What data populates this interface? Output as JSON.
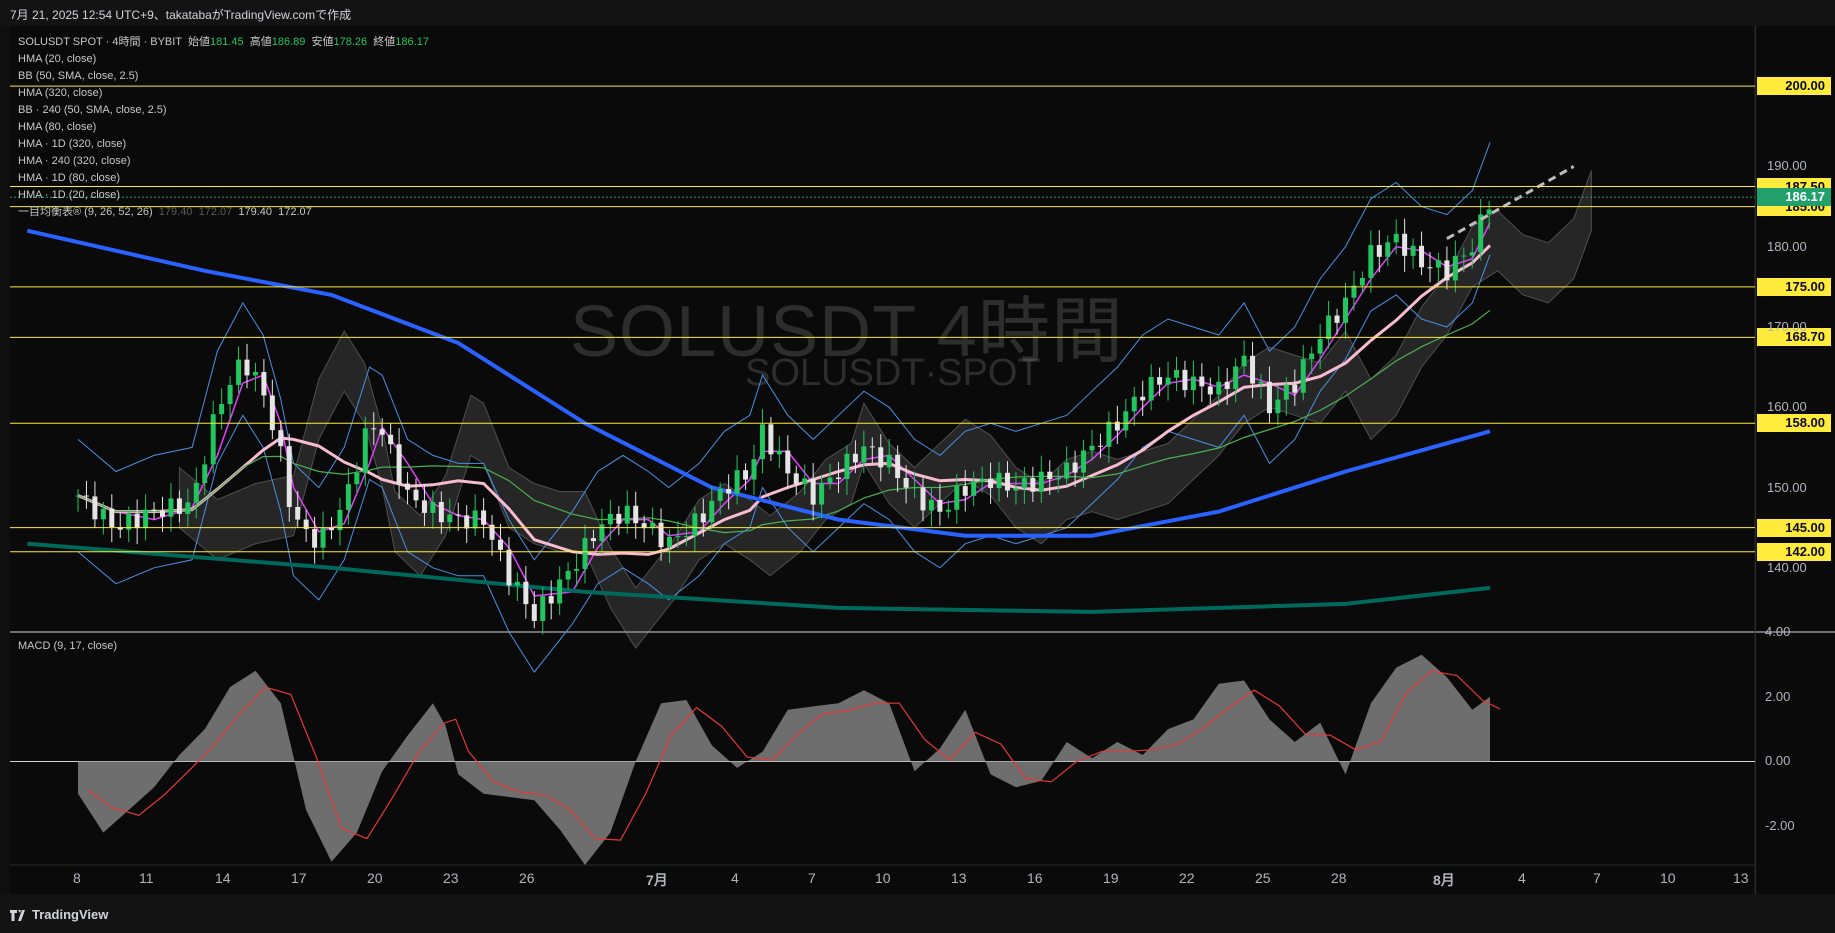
{
  "header": {
    "caption": "7月 21, 2025 12:54 UTC+9、takatabaがTradingView.comで作成"
  },
  "legend": {
    "symbol": "SOLUSDT SPOT · 4時間 · BYBIT",
    "open_label": "始値",
    "open": "181.45",
    "high_label": "高値",
    "high": "186.89",
    "low_label": "安値",
    "low": "178.26",
    "close_label": "終値",
    "close": "186.17",
    "indicators": [
      "HMA (20, close)",
      "BB (50, SMA, close, 2.5)",
      "HMA (320, close)",
      "BB · 240 (50, SMA, close, 2.5)",
      "HMA (80, close)",
      "HMA · 1D (320, close)",
      "HMA · 240 (320, close)",
      "HMA · 1D (80, close)",
      "HMA · 1D (20, close)"
    ],
    "ichimoku": "一目均衡表® (9, 26, 52, 26)",
    "ichimoku_values": [
      "179.40",
      "172.07",
      "179.40",
      "172.07"
    ],
    "macd": "MACD (9, 17, close)"
  },
  "watermark": {
    "line1": "SOLUSDT 4時間",
    "line2": "SOLUSDT·SPOT"
  },
  "colors": {
    "up": "#22c55e",
    "down": "#e5e5e5",
    "hma20": "#e040fb",
    "hma_pink": "#f8bbd0",
    "hma_blue": "#2962ff",
    "hma_teal": "#00695c",
    "bb": "#4a90e2",
    "green_ma": "#4caf50",
    "level": "#ffeb3b",
    "macd_hist": "#808080",
    "macd_signal": "#e53935"
  },
  "chart_data": [
    {
      "type": "candlestick",
      "title": "SOLUSDT SPOT · 4時間 · BYBIT",
      "ylim": [
        132,
        207
      ],
      "price_axis_ticks": [
        "190.00",
        "180.00",
        "170.00",
        "160.00",
        "150.00",
        "140.00"
      ],
      "horizontal_levels": [
        "200.00",
        "187.50",
        "185.00",
        "175.00",
        "168.70",
        "158.00",
        "145.00",
        "142.00"
      ],
      "current_price": "186.17",
      "x_ticks": [
        "8",
        "11",
        "14",
        "17",
        "20",
        "23",
        "26",
        "7月",
        "4",
        "7",
        "10",
        "13",
        "16",
        "19",
        "22",
        "25",
        "28",
        "8月",
        "4",
        "7",
        "10",
        "13"
      ],
      "price_path": [
        [
          0,
          149
        ],
        [
          1.5,
          145
        ],
        [
          3,
          147
        ],
        [
          4.5,
          148
        ],
        [
          5.5,
          160
        ],
        [
          6.5,
          166
        ],
        [
          7.3,
          162
        ],
        [
          8,
          154
        ],
        [
          8.5,
          146
        ],
        [
          9.5,
          143
        ],
        [
          10.5,
          148
        ],
        [
          11.5,
          158
        ],
        [
          12,
          157
        ],
        [
          13,
          149
        ],
        [
          14,
          147
        ],
        [
          15,
          146
        ],
        [
          16,
          146
        ],
        [
          17,
          139
        ],
        [
          18,
          134
        ],
        [
          19.5,
          140
        ],
        [
          20.5,
          145
        ],
        [
          21.5,
          147
        ],
        [
          22.5,
          145
        ],
        [
          23.3,
          143
        ],
        [
          24.5,
          146
        ],
        [
          25.5,
          150
        ],
        [
          26.5,
          152
        ],
        [
          27,
          157
        ],
        [
          28,
          152
        ],
        [
          29,
          149
        ],
        [
          30,
          152
        ],
        [
          31,
          155
        ],
        [
          32,
          153
        ],
        [
          33,
          149
        ],
        [
          34,
          147
        ],
        [
          35,
          150
        ],
        [
          36,
          151
        ],
        [
          37,
          150
        ],
        [
          38,
          151
        ],
        [
          39,
          152
        ],
        [
          40,
          155
        ],
        [
          41,
          158
        ],
        [
          42,
          162
        ],
        [
          43,
          164
        ],
        [
          44,
          163
        ],
        [
          45,
          162
        ],
        [
          46,
          166
        ],
        [
          47,
          160
        ],
        [
          48,
          163
        ],
        [
          49,
          169
        ],
        [
          50,
          173
        ],
        [
          51,
          179
        ],
        [
          52,
          181
        ],
        [
          53,
          178
        ],
        [
          54,
          177
        ],
        [
          55,
          180
        ],
        [
          55.7,
          186
        ]
      ]
    },
    {
      "type": "area",
      "title": "MACD (9, 17, close)",
      "ylim": [
        -3.2,
        4.0
      ],
      "axis_ticks": [
        "4.00",
        "2.00",
        "0.00",
        "-2.00"
      ],
      "histogram": [
        [
          0,
          -1.0
        ],
        [
          1,
          -2.2
        ],
        [
          2,
          -1.5
        ],
        [
          3,
          -0.8
        ],
        [
          4,
          0.2
        ],
        [
          5,
          1.0
        ],
        [
          6,
          2.3
        ],
        [
          7,
          2.8
        ],
        [
          8,
          1.8
        ],
        [
          9,
          -1.5
        ],
        [
          10,
          -3.1
        ],
        [
          11,
          -2.2
        ],
        [
          12,
          -0.3
        ],
        [
          13,
          0.8
        ],
        [
          14,
          1.8
        ],
        [
          14.5,
          1.1
        ],
        [
          15,
          -0.4
        ],
        [
          16,
          -1.0
        ],
        [
          17,
          -1.1
        ],
        [
          18,
          -1.2
        ],
        [
          19,
          -2.1
        ],
        [
          20,
          -3.2
        ],
        [
          21,
          -2.2
        ],
        [
          22,
          0.0
        ],
        [
          23,
          1.8
        ],
        [
          24,
          1.9
        ],
        [
          25,
          0.5
        ],
        [
          26,
          -0.2
        ],
        [
          27,
          0.3
        ],
        [
          28,
          1.6
        ],
        [
          29,
          1.7
        ],
        [
          30,
          1.8
        ],
        [
          31,
          2.2
        ],
        [
          32,
          1.8
        ],
        [
          33,
          -0.3
        ],
        [
          34,
          0.4
        ],
        [
          35,
          1.6
        ],
        [
          36,
          -0.4
        ],
        [
          37,
          -0.8
        ],
        [
          38,
          -0.6
        ],
        [
          39,
          0.6
        ],
        [
          40,
          0.1
        ],
        [
          41,
          0.6
        ],
        [
          42,
          0.2
        ],
        [
          43,
          1.0
        ],
        [
          44,
          1.3
        ],
        [
          45,
          2.4
        ],
        [
          46,
          2.5
        ],
        [
          47,
          1.3
        ],
        [
          48,
          0.6
        ],
        [
          49,
          1.2
        ],
        [
          50,
          -0.4
        ],
        [
          51,
          1.8
        ],
        [
          52,
          2.9
        ],
        [
          53,
          3.3
        ],
        [
          54,
          2.6
        ],
        [
          55,
          1.6
        ],
        [
          55.7,
          2.0
        ]
      ]
    }
  ]
}
